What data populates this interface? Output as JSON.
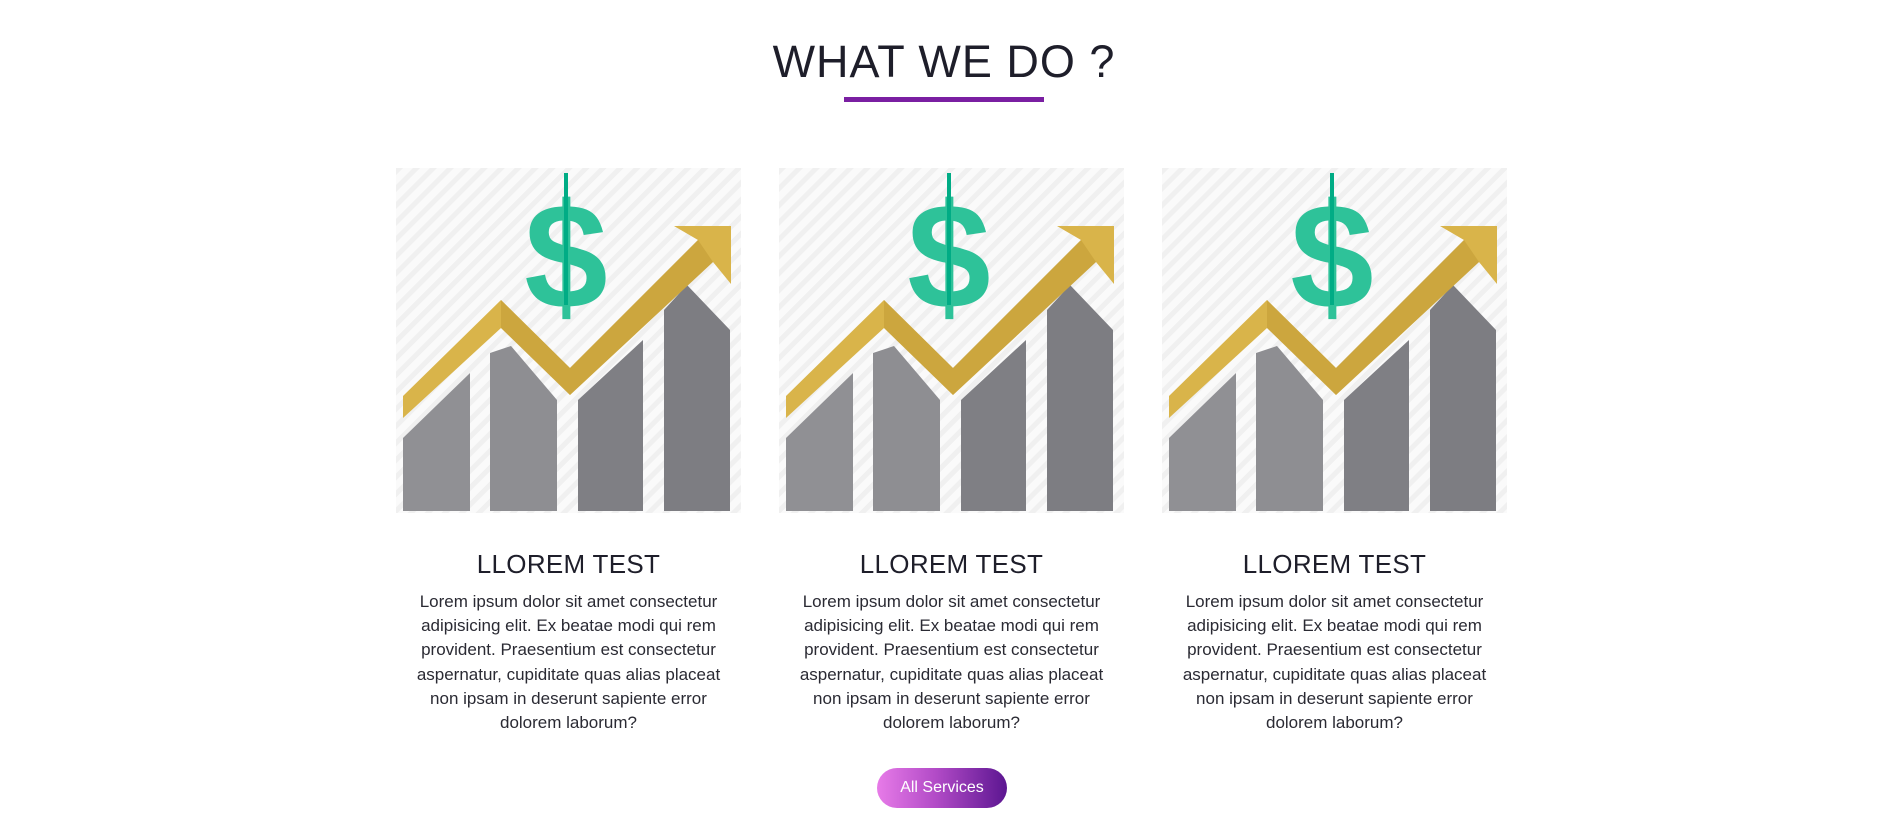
{
  "section": {
    "title": "WHAT WE DO ?",
    "accent_color": "#7a1fa2"
  },
  "cards": [
    {
      "title": "LLOREM TEST",
      "text": "Lorem ipsum dolor sit amet consectetur adipisicing elit. Ex beatae modi qui rem provident. Praesentium est consectetur aspernatur, cupiditate quas alias placeat non ipsam in deserunt sapiente error dolorem laborum?",
      "image_icon": "growth-chart-dollar-icon"
    },
    {
      "title": "LLOREM TEST",
      "text": "Lorem ipsum dolor sit amet consectetur adipisicing elit. Ex beatae modi qui rem provident. Praesentium est consectetur aspernatur, cupiditate quas alias placeat non ipsam in deserunt sapiente error dolorem laborum?",
      "image_icon": "growth-chart-dollar-icon"
    },
    {
      "title": "LLOREM TEST",
      "text": "Lorem ipsum dolor sit amet consectetur adipisicing elit. Ex beatae modi qui rem provident. Praesentium est consectetur aspernatur, cupiditate quas alias placeat non ipsam in deserunt sapiente error dolorem laborum?",
      "image_icon": "growth-chart-dollar-icon"
    }
  ],
  "button": {
    "label": "All Services",
    "gradient": [
      "#e77be8",
      "#5c1691"
    ]
  },
  "illustration_colors": {
    "dollar_light": "#58cba8",
    "dollar_dark": "#00ac85",
    "arrow_light": "#d9b44a",
    "arrow_dark": "#c19a35",
    "bar_light": "#909094",
    "bar_dark": "#7d7d82",
    "background_stripe": "#f1f1f1"
  }
}
